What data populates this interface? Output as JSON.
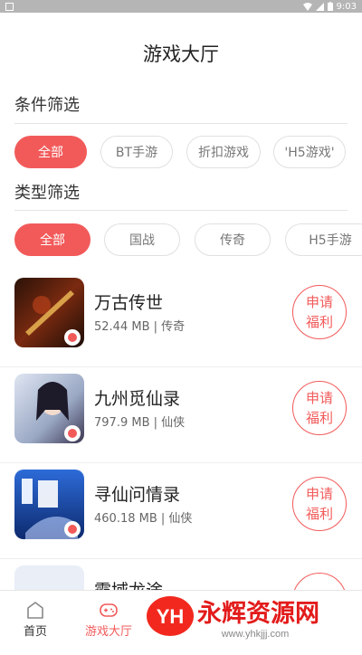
{
  "status_bar": {
    "time": "9:03"
  },
  "page_title": "游戏大厅",
  "filters": {
    "condition": {
      "label": "条件筛选",
      "chips": [
        "全部",
        "BT手游",
        "折扣游戏",
        "'H5游戏'"
      ],
      "active_index": 0
    },
    "type": {
      "label": "类型筛选",
      "chips": [
        "全部",
        "国战",
        "传奇",
        "H5手游"
      ],
      "active_index": 0
    }
  },
  "games": [
    {
      "name": "万古传世",
      "size": "52.44 MB",
      "category": "传奇",
      "meta": "52.44 MB | 传奇",
      "apply_line1": "申请",
      "apply_line2": "福利"
    },
    {
      "name": "九州觅仙录",
      "size": "797.9 MB",
      "category": "仙侠",
      "meta": "797.9 MB | 仙侠",
      "apply_line1": "申请",
      "apply_line2": "福利"
    },
    {
      "name": "寻仙问情录",
      "size": "460.18 MB",
      "category": "仙侠",
      "meta": "460.18 MB | 仙侠",
      "apply_line1": "申请",
      "apply_line2": "福利"
    },
    {
      "name": "霸域龙途",
      "apply_line1": "申请"
    }
  ],
  "tabbar": {
    "home_label": "首页",
    "hall_label": "游戏大厅",
    "active": "hall"
  },
  "watermark": {
    "brand": "永辉资源网",
    "logo": "YH",
    "url": "www.yhkjjj.com"
  },
  "colors": {
    "accent": "#f25a5a"
  }
}
